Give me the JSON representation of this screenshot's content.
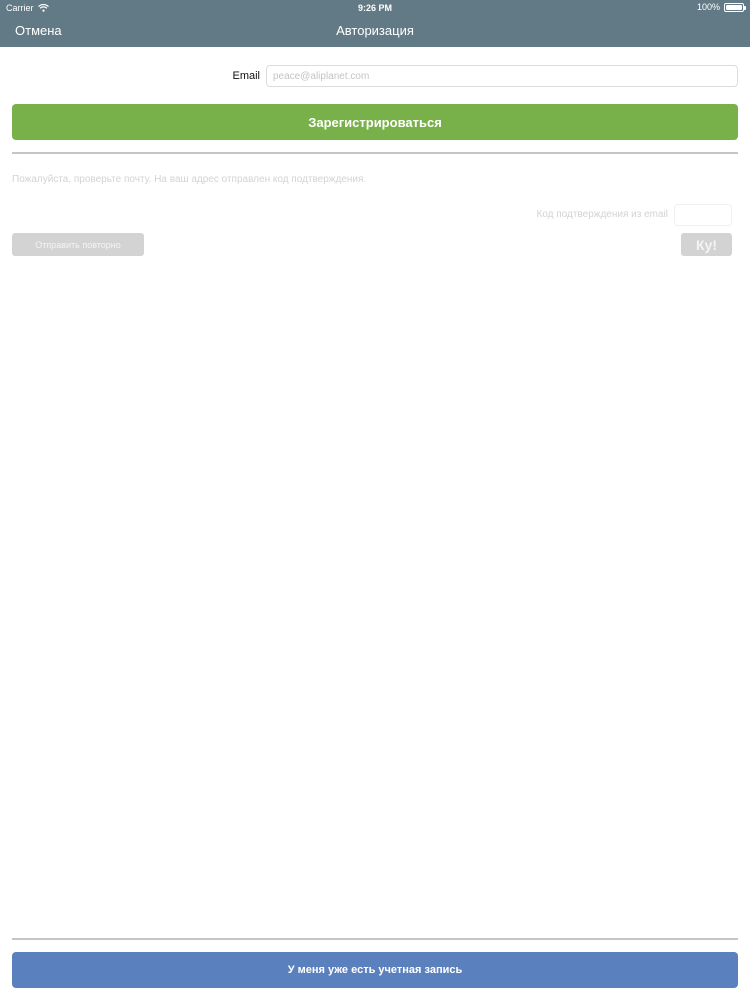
{
  "status_bar": {
    "carrier": "Carrier",
    "time": "9:26 PM",
    "battery": "100%"
  },
  "nav": {
    "cancel_label": "Отмена",
    "title": "Авторизация"
  },
  "form": {
    "email_label": "Email",
    "email_placeholder": "peace@aliplanet.com",
    "email_value": "",
    "register_label": "Зарегистрироваться",
    "check_mail_message": "Пожалуйста, проверьте почту. На ваш адрес отправлен код подтверждения.",
    "code_label": "Код подтверждения из email",
    "code_value": "",
    "resend_label": "Отправить повторно",
    "ok_label": "Ку!"
  },
  "footer": {
    "login_label": "У меня уже есть учетная запись"
  },
  "colors": {
    "nav_background": "#627a86",
    "register_button": "#78b04a",
    "login_button": "#5b80be",
    "disabled_button": "#d3d3d3"
  }
}
